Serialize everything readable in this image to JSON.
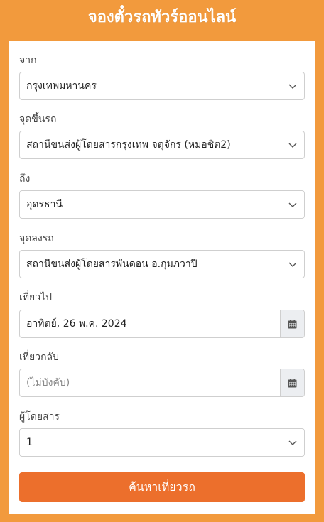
{
  "header": {
    "title": "จองตั๋วรถทัวร์ออนไลน์"
  },
  "form": {
    "from": {
      "label": "จาก",
      "value": "กรุงเทพมหานคร"
    },
    "pickup": {
      "label": "จุดขึ้นรถ",
      "value": "สถานีขนส่งผู้โดยสารกรุงเทพ จตุจักร (หมอชิต2)"
    },
    "to": {
      "label": "ถึง",
      "value": "อุดรธานี"
    },
    "dropoff": {
      "label": "จุดลงรถ",
      "value": "สถานีขนส่งผู้โดยสารพันดอน อ.กุมภวาปี"
    },
    "depart": {
      "label": "เที่ยวไป",
      "value": "อาทิตย์, 26 พ.ค. 2024"
    },
    "return": {
      "label": "เที่ยวกลับ",
      "placeholder": "(ไม่บังคับ)"
    },
    "passengers": {
      "label": "ผู้โดยสาร",
      "value": "1"
    },
    "search_label": "ค้นหาเที่ยวรถ"
  },
  "icons": {
    "select_arrow": "chevron-down-icon",
    "date_picker": "calendar-icon"
  },
  "colors": {
    "background": "#f29a3d",
    "button": "#ec6f2c"
  }
}
